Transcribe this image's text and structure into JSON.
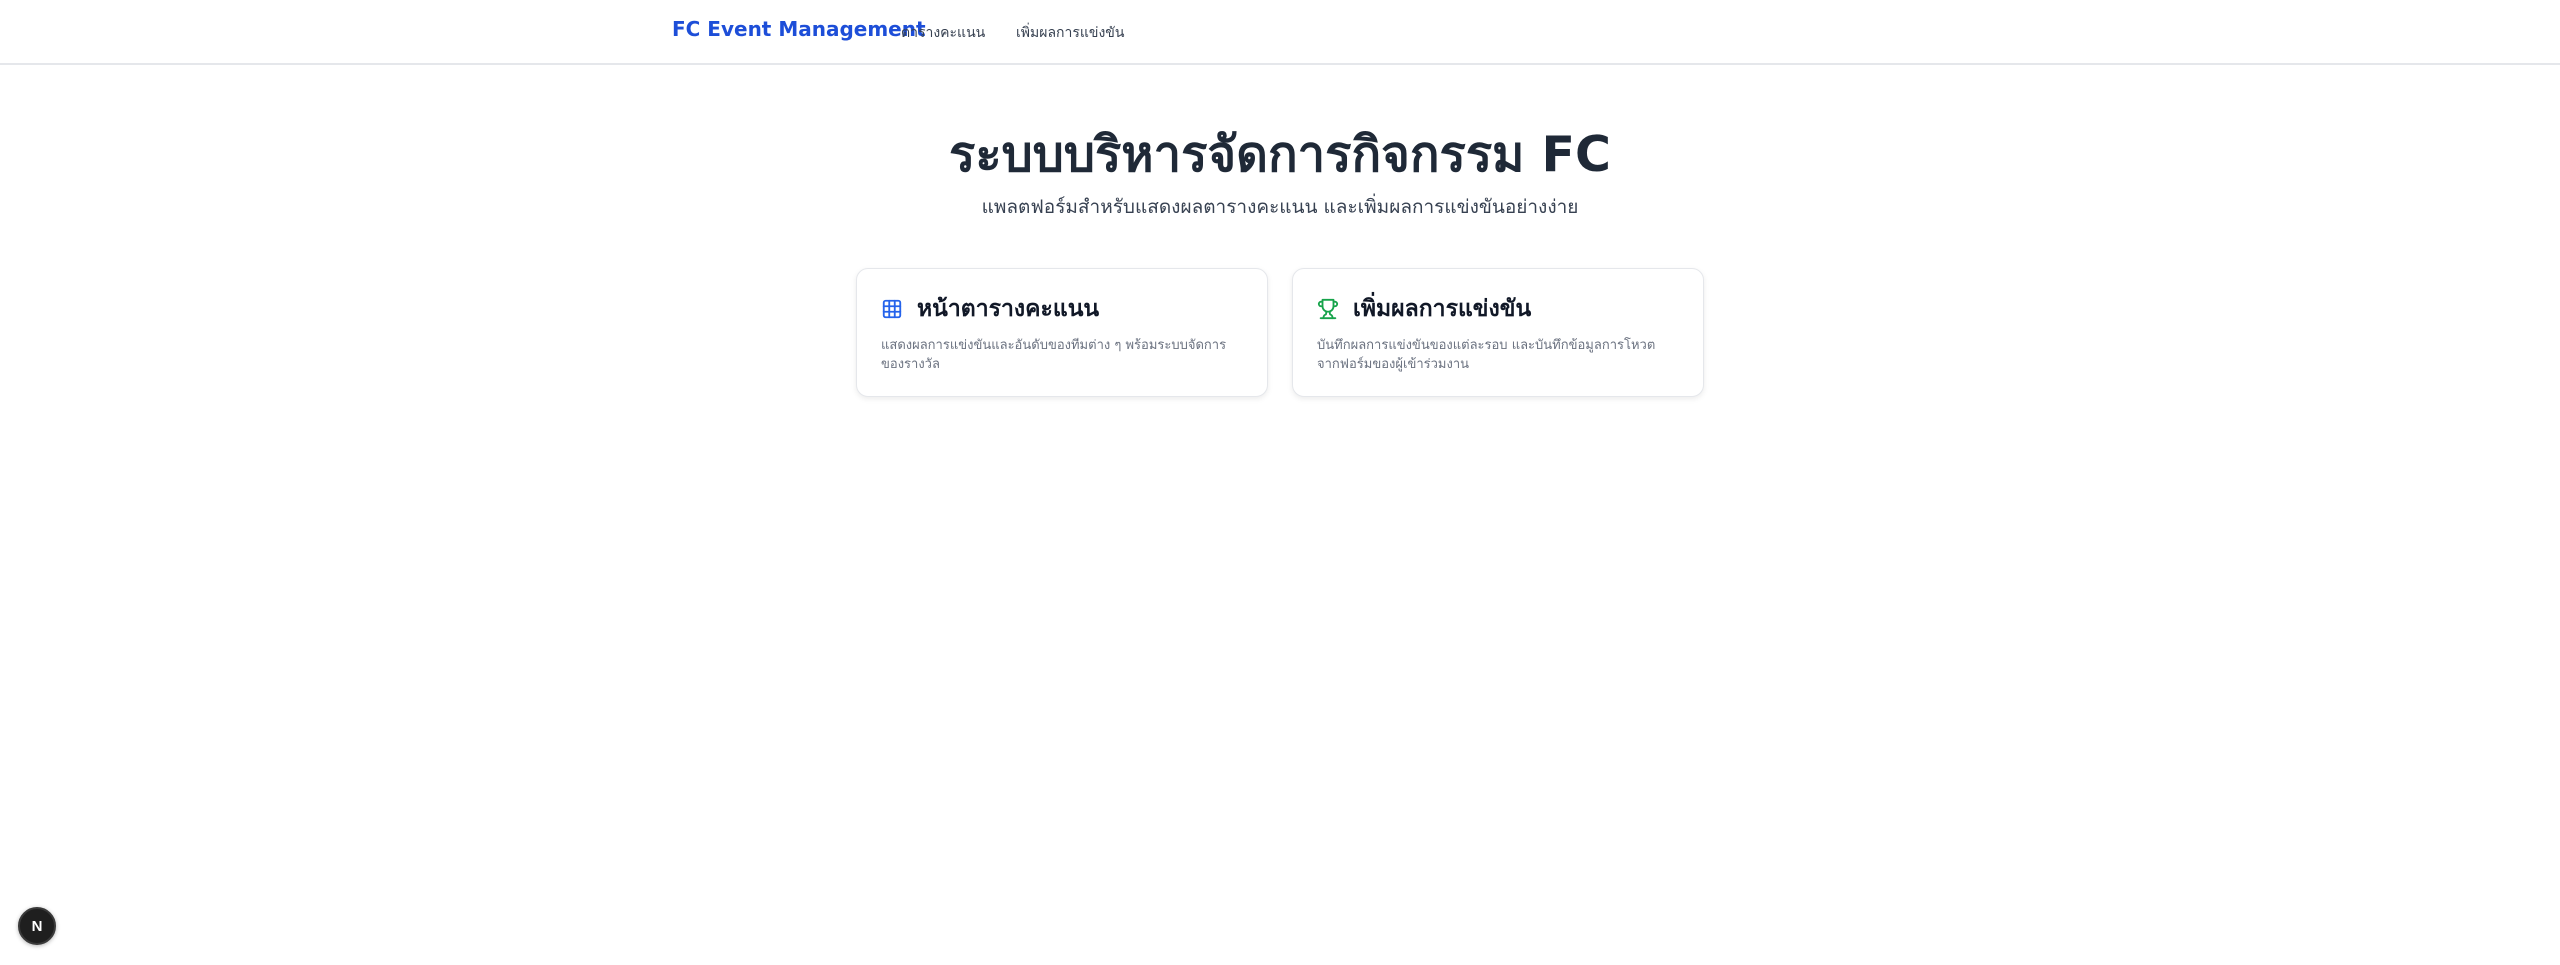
{
  "nav": {
    "brand": "FC Event Management",
    "links": [
      {
        "label": "ตารางคะแนน"
      },
      {
        "label": "เพิ่มผลการแข่งขัน"
      }
    ]
  },
  "hero": {
    "title": "ระบบบริหารจัดการกิจกรรม FC",
    "subtitle": "แพลตฟอร์มสำหรับแสดงผลตารางคะแนน และเพิ่มผลการแข่งขันอย่างง่าย"
  },
  "cards": [
    {
      "icon": "table-icon",
      "title": "หน้าตารางคะแนน",
      "description": "แสดงผลการแข่งขันและอันดับของทีมต่าง ๆ พร้อมระบบจัดการของรางวัล",
      "icon_color": "#2563eb"
    },
    {
      "icon": "trophy-icon",
      "title": "เพิ่มผลการแข่งขัน",
      "description": "บันทึกผลการแข่งขันของแต่ละรอบ และบันทึกข้อมูลการโหวตจากฟอร์มของผู้เข้าร่วมงาน",
      "icon_color": "#16a34a"
    }
  ],
  "dev_badge": {
    "letter": "N"
  },
  "colors": {
    "brand": "#1d4ed8",
    "text_dark": "#1f2937",
    "text_muted": "#6b7280",
    "border": "#e5e7eb"
  }
}
